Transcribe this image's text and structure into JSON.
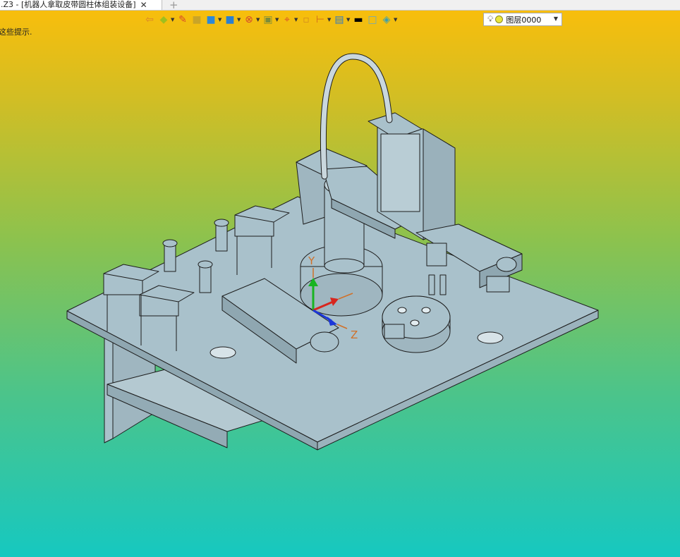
{
  "tab": {
    "title": ".Z3 - [机器人拿取皮带圆柱体组装设备]",
    "close": "✕",
    "new_tab": "+"
  },
  "status_hint": "这些提示.",
  "toolbar": {
    "tools": [
      {
        "name": "import-icon",
        "glyph": "⇦",
        "color": "#d9822b",
        "dropdown": false
      },
      {
        "name": "fill-icon",
        "glyph": "◆",
        "color": "#9fbf1e",
        "dropdown": true
      },
      {
        "name": "pencil-icon",
        "glyph": "✎",
        "color": "#d84a2b",
        "dropdown": false
      },
      {
        "name": "box-icon",
        "glyph": "■",
        "color": "#c9a428",
        "dropdown": false
      },
      {
        "name": "solid-icon",
        "glyph": "■",
        "color": "#2c88d8",
        "dropdown": true
      },
      {
        "name": "shaded-icon",
        "glyph": "■",
        "color": "#2a7fd0",
        "dropdown": true
      },
      {
        "name": "sphere-icon",
        "glyph": "⊗",
        "color": "#d44a2e",
        "dropdown": true
      },
      {
        "name": "frame-icon",
        "glyph": "▣",
        "color": "#7c8c3a",
        "dropdown": true
      },
      {
        "name": "target-icon",
        "glyph": "⌖",
        "color": "#d8502a",
        "dropdown": true
      },
      {
        "name": "square-icon",
        "glyph": "▫",
        "color": "#d28a20",
        "dropdown": false
      },
      {
        "name": "measure-icon",
        "glyph": "⊢",
        "color": "#d26a1c",
        "dropdown": true
      },
      {
        "name": "monitor-icon",
        "glyph": "▤",
        "color": "#2c78c8",
        "dropdown": true
      },
      {
        "name": "line-color-icon",
        "glyph": "▬",
        "color": "#000000",
        "dropdown": false
      },
      {
        "name": "face-color-icon",
        "glyph": "□",
        "color": "#6aa8c0",
        "dropdown": false
      },
      {
        "name": "layers-icon",
        "glyph": "◈",
        "color": "#3aa0b0",
        "dropdown": true
      }
    ],
    "layer": {
      "value": "图层0000"
    }
  },
  "axis": {
    "y_label": "Y",
    "z_label": "Z"
  },
  "colors": {
    "part_fill": "#a9c1cb",
    "part_edge": "#1d1d1d",
    "hose": "#c9d7dd",
    "axis_x": "#d8261e",
    "axis_y": "#18b421",
    "axis_z": "#1c37d9",
    "axis_label": "#d07028"
  }
}
